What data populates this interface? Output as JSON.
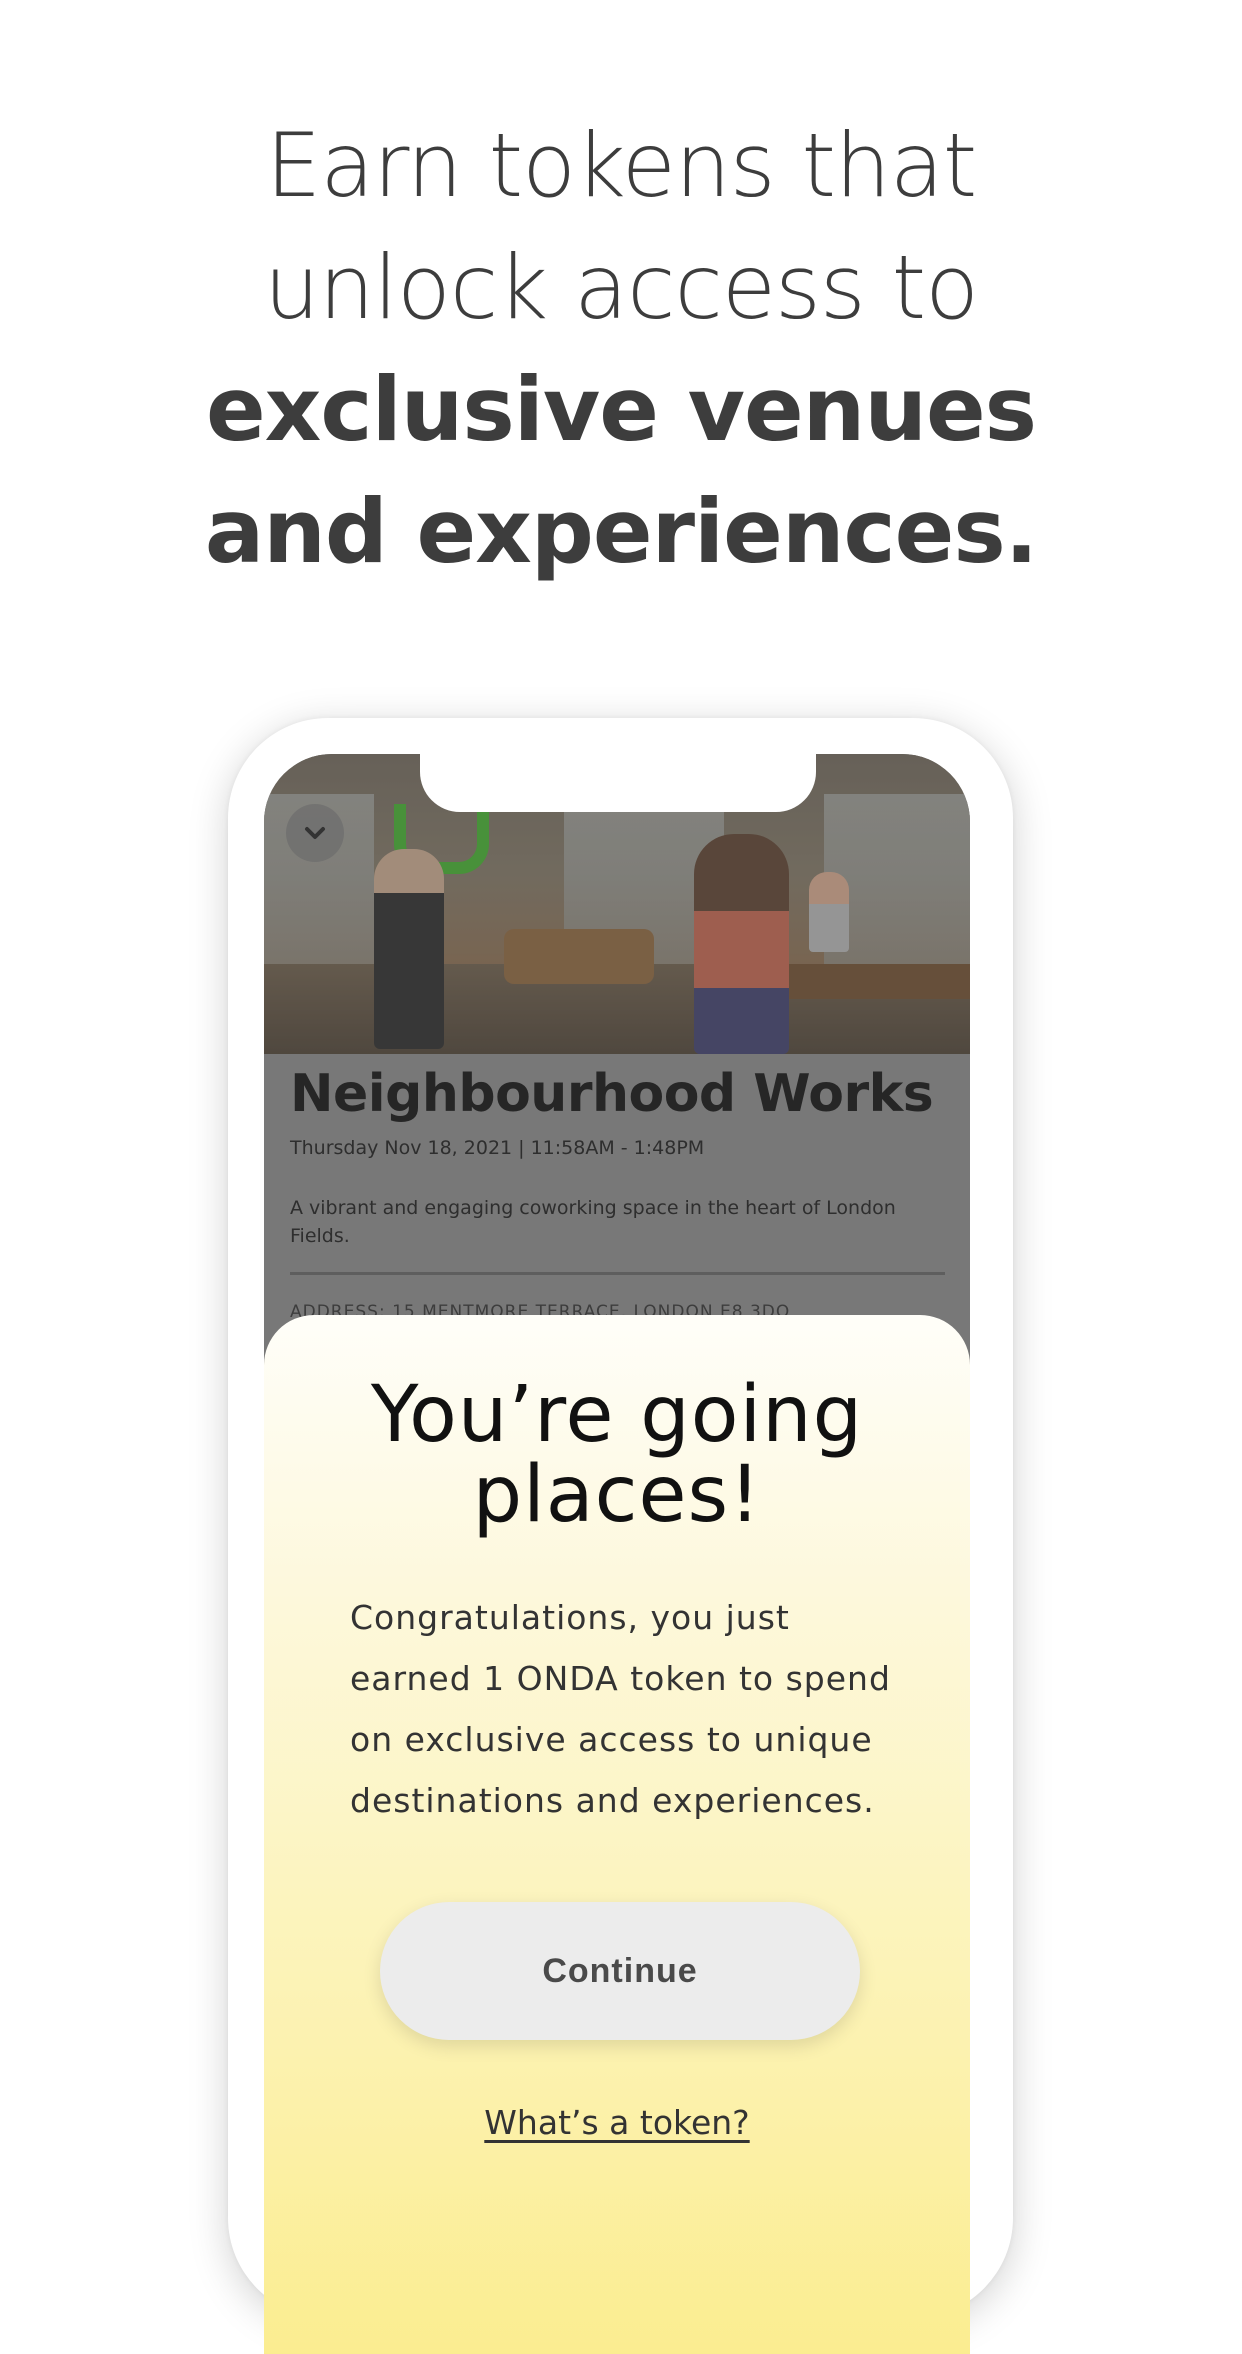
{
  "headline": {
    "line1": "Earn tokens that",
    "line2": "unlock access to",
    "line3": "exclusive venues",
    "line4": "and experiences."
  },
  "venue": {
    "name": "Neighbourhood Works",
    "datetime": "Thursday Nov 18, 2021 | 11:58AM - 1:48PM",
    "description": "A vibrant and engaging coworking space in the heart of London Fields.",
    "address": "ADDRESS: 15 MENTMORE TERRACE, LONDON E8 3DQ"
  },
  "modal": {
    "title": "You’re going places!",
    "body": "Congratulations, you just earned 1 ONDA token to spend on exclusive access to unique destinations and experiences.",
    "continue_label": "Continue",
    "token_link_label": "What’s a token?"
  },
  "icons": {
    "collapse": "chevron-down-icon"
  },
  "colors": {
    "headline_text": "#3d3d3d",
    "sheet_gradient_top": "#fffef9",
    "sheet_gradient_bottom": "#fbec8a",
    "button_bg": "#ececec"
  }
}
